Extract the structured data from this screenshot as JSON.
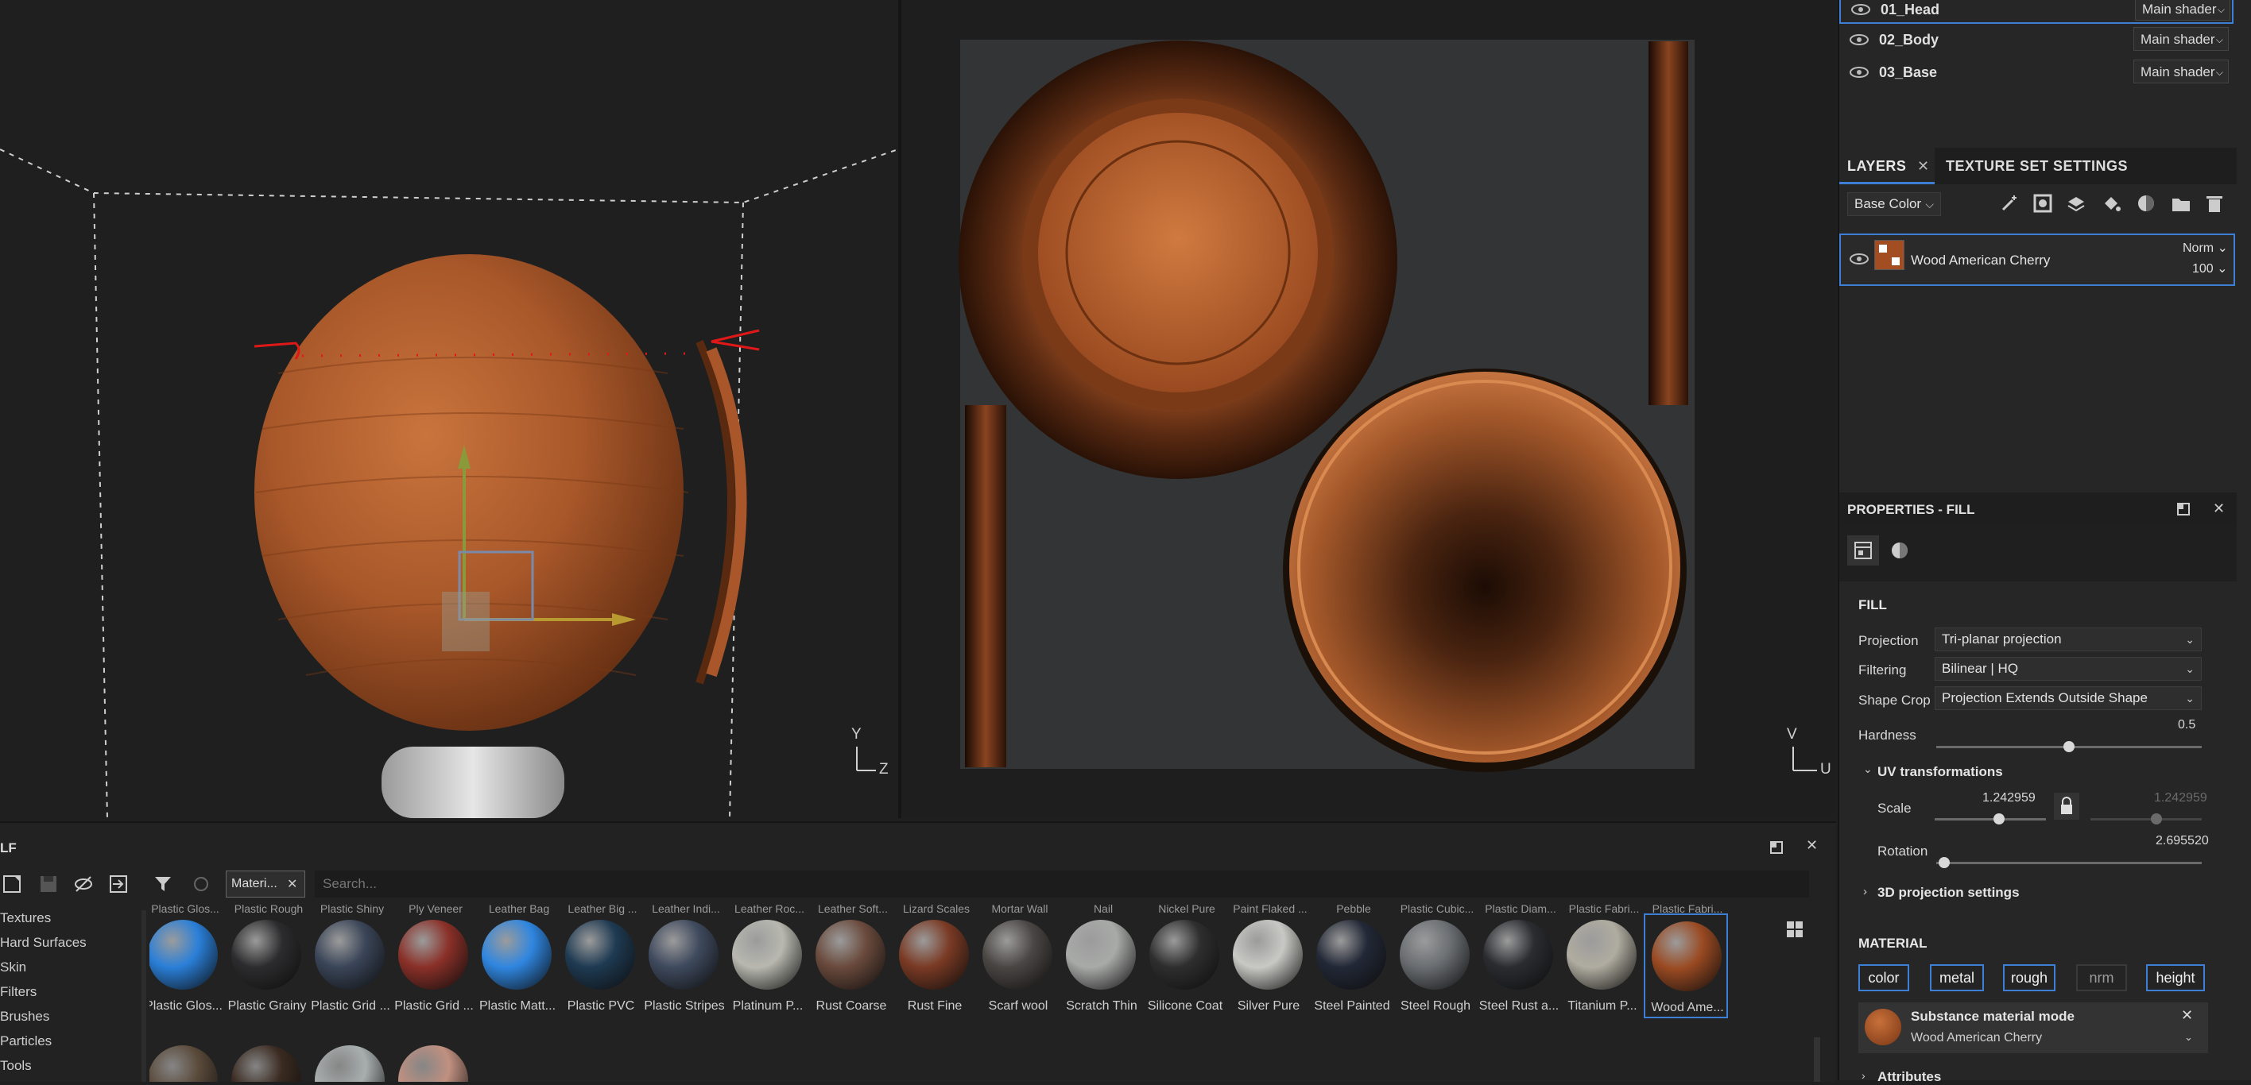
{
  "texture_sets": [
    {
      "name": "01_Head",
      "shader": "Main shader"
    },
    {
      "name": "02_Body",
      "shader": "Main shader"
    },
    {
      "name": "03_Base",
      "shader": "Main shader"
    }
  ],
  "layers_panel": {
    "tab_layers": "LAYERS",
    "tab_texture_set_settings": "TEXTURE SET SETTINGS",
    "channel_dropdown": "Base Color",
    "layer": {
      "name": "Wood American Cherry",
      "blend": "Norm",
      "opacity": "100"
    }
  },
  "properties": {
    "title": "PROPERTIES - FILL",
    "fill_heading": "FILL",
    "projection_label": "Projection",
    "projection_value": "Tri-planar projection",
    "filtering_label": "Filtering",
    "filtering_value": "Bilinear | HQ",
    "shape_crop_label": "Shape Crop",
    "shape_crop_value": "Projection Extends Outside Shape",
    "hardness_label": "Hardness",
    "hardness_value": "0.5",
    "uv_heading": "UV transformations",
    "scale_label": "Scale",
    "scale_value": "1.242959",
    "scale_value_2": "1.242959",
    "rotation_label": "Rotation",
    "rotation_value": "2.695520",
    "projection3d_heading": "3D projection settings",
    "material_heading": "MATERIAL",
    "channels": [
      "color",
      "metal",
      "rough",
      "nrm",
      "height"
    ],
    "material_mode_title": "Substance material mode",
    "material_mode_value": "Wood American Cherry",
    "attributes_heading": "Attributes"
  },
  "viewport3d": {
    "axis_y": "Y",
    "axis_z": "Z"
  },
  "viewport2d": {
    "axis_v": "V",
    "axis_u": "U"
  },
  "shelf": {
    "title": "LF",
    "search_tab": "Materi...",
    "search_placeholder": "Search...",
    "categories": [
      "Textures",
      "Hard Surfaces",
      "Skin",
      "Filters",
      "Brushes",
      "Particles",
      "Tools"
    ],
    "header_labels": [
      "Plastic Glos...",
      "Plastic Rough",
      "Plastic Shiny",
      "Ply Veneer",
      "Leather Bag",
      "Leather Big ...",
      "Leather Indi...",
      "Leather Roc...",
      "Leather Soft...",
      "Lizard Scales",
      "Mortar Wall",
      "Nail",
      "Nickel Pure",
      "Paint Flaked ...",
      "Pebble",
      "Plastic Cubic...",
      "Plastic Diam...",
      "Plastic Fabri...",
      "Plastic Fabri..."
    ],
    "items": [
      {
        "label": "Plastic Glos...",
        "color": "#2a7fd8"
      },
      {
        "label": "Plastic Grainy",
        "color": "#2c2c2e"
      },
      {
        "label": "Plastic Grid ...",
        "color": "#3a4558"
      },
      {
        "label": "Plastic Grid ...",
        "color": "#8a3028"
      },
      {
        "label": "Plastic Matt...",
        "color": "#2f86e0"
      },
      {
        "label": "Plastic PVC",
        "color": "#1e3a52"
      },
      {
        "label": "Plastic Stripes",
        "color": "#3f4a5e"
      },
      {
        "label": "Platinum P...",
        "color": "#b8b8b0"
      },
      {
        "label": "Rust Coarse",
        "color": "#6a4a3c"
      },
      {
        "label": "Rust Fine",
        "color": "#7a3a24"
      },
      {
        "label": "Scarf wool",
        "color": "#4a4644"
      },
      {
        "label": "Scratch Thin",
        "color": "#a8aaa8"
      },
      {
        "label": "Silicone Coat",
        "color": "#2e2e2e"
      },
      {
        "label": "Silver Pure",
        "color": "#c8c8c4"
      },
      {
        "label": "Steel Painted",
        "color": "#222836"
      },
      {
        "label": "Steel Rough",
        "color": "#6a6e72"
      },
      {
        "label": "Steel Rust a...",
        "color": "#2a2c30"
      },
      {
        "label": "Titanium P...",
        "color": "#b0aca0"
      },
      {
        "label": "Wood Ame...",
        "color": "#9a4a22"
      }
    ],
    "row2": [
      {
        "color": "#5a4a3a"
      },
      {
        "color": "#3a2a20"
      },
      {
        "color": "#a8aeae"
      },
      {
        "color": "#c09080"
      }
    ]
  }
}
